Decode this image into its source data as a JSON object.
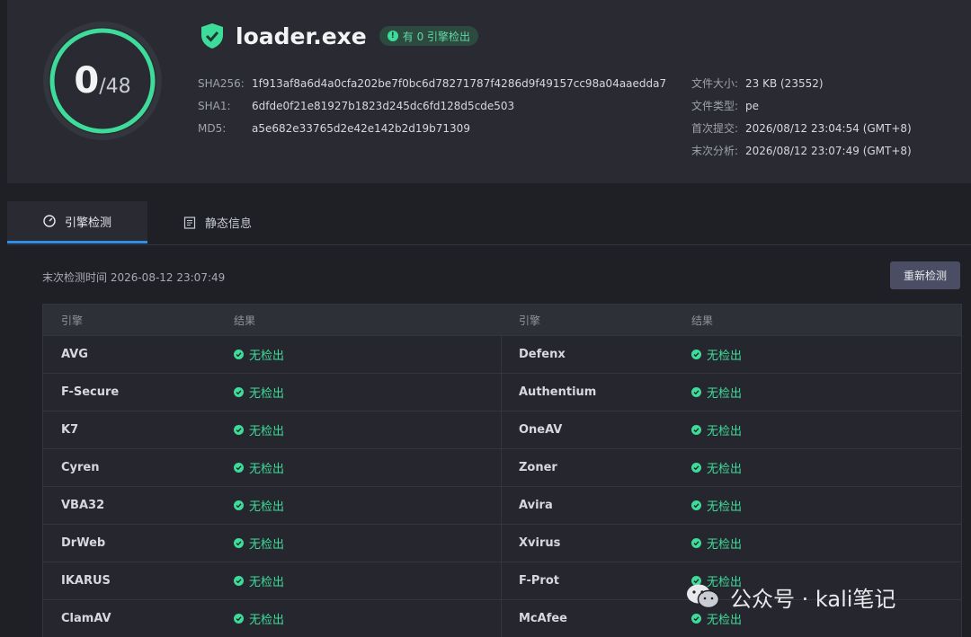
{
  "score": {
    "detected": "0",
    "total": "/48"
  },
  "file": {
    "name": "loader.exe",
    "badge": "有 0 引擎检出",
    "hashes": [
      {
        "key": "SHA256:",
        "value": "1f913af8a6d4a0cfa202be7f0bc6d78271787f4286d9f49157cc98a04aaedda7"
      },
      {
        "key": "SHA1:",
        "value": "6dfde0f21e81927b1823d245dc6fd128d5cde503"
      },
      {
        "key": "MD5:",
        "value": "a5e682e33765d2e42e142b2d19b71309"
      }
    ],
    "meta": [
      {
        "key": "文件大小:",
        "value": "23 KB (23552)"
      },
      {
        "key": "文件类型:",
        "value": "pe"
      },
      {
        "key": "首次提交:",
        "value": "2026/08/12 23:04:54 (GMT+8)"
      },
      {
        "key": "末次分析:",
        "value": "2026/08/12 23:07:49 (GMT+8)"
      }
    ]
  },
  "tabs": [
    {
      "label": "引擎检测",
      "icon": "gauge-icon"
    },
    {
      "label": "静态信息",
      "icon": "document-icon"
    }
  ],
  "scan": {
    "last_scan": "末次检测时间 2026-08-12 23:07:49",
    "rescan_label": "重新检测"
  },
  "table": {
    "headers": [
      "引擎",
      "结果",
      "引擎",
      "结果"
    ],
    "rows": [
      {
        "left": {
          "engine": "AVG",
          "result": "无检出"
        },
        "right": {
          "engine": "Defenx",
          "result": "无检出"
        }
      },
      {
        "left": {
          "engine": "F-Secure",
          "result": "无检出"
        },
        "right": {
          "engine": "Authentium",
          "result": "无检出"
        }
      },
      {
        "left": {
          "engine": "K7",
          "result": "无检出"
        },
        "right": {
          "engine": "OneAV",
          "result": "无检出"
        }
      },
      {
        "left": {
          "engine": "Cyren",
          "result": "无检出"
        },
        "right": {
          "engine": "Zoner",
          "result": "无检出"
        }
      },
      {
        "left": {
          "engine": "VBA32",
          "result": "无检出"
        },
        "right": {
          "engine": "Avira",
          "result": "无检出"
        }
      },
      {
        "left": {
          "engine": "DrWeb",
          "result": "无检出"
        },
        "right": {
          "engine": "Xvirus",
          "result": "无检出"
        }
      },
      {
        "left": {
          "engine": "IKARUS",
          "result": "无检出"
        },
        "right": {
          "engine": "F-Prot",
          "result": "无检出"
        }
      },
      {
        "left": {
          "engine": "ClamAV",
          "result": "无检出"
        },
        "right": {
          "engine": "McAfee",
          "result": "无检出"
        }
      }
    ]
  },
  "watermark": {
    "text": "公众号 · kali笔记",
    "icon": "wechat-icon"
  },
  "colors": {
    "accent_green": "#3ddc9a",
    "tab_active": "#2f8ee8",
    "background": "#1f2026"
  }
}
